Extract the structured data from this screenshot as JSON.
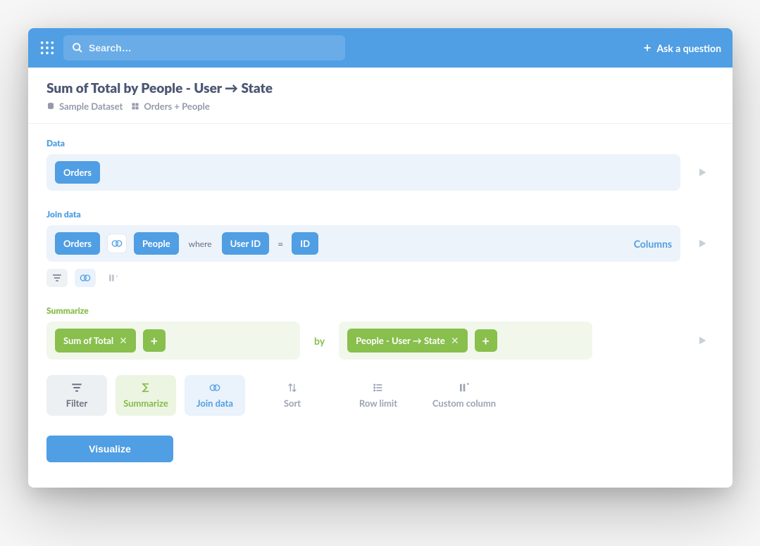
{
  "header": {
    "search_placeholder": "Search…",
    "ask_label": "Ask a question"
  },
  "title": {
    "text": "Sum of Total by People - User → State",
    "dataset_label": "Sample Dataset",
    "tables_label": "Orders + People"
  },
  "sections": {
    "data_label": "Data",
    "join_label": "Join data",
    "summarize_label": "Summarize"
  },
  "data": {
    "table": "Orders"
  },
  "join": {
    "left_table": "Orders",
    "right_table": "People",
    "where_label": "where",
    "left_col": "User ID",
    "eq": "=",
    "right_col": "ID",
    "columns_label": "Columns"
  },
  "summarize": {
    "aggregate": "Sum of Total",
    "by_label": "by",
    "breakout": "People - User → State"
  },
  "actions": {
    "filter": "Filter",
    "summarize": "Summarize",
    "join": "Join data",
    "sort": "Sort",
    "row_limit": "Row limit",
    "custom_column": "Custom column"
  },
  "visualize_label": "Visualize"
}
